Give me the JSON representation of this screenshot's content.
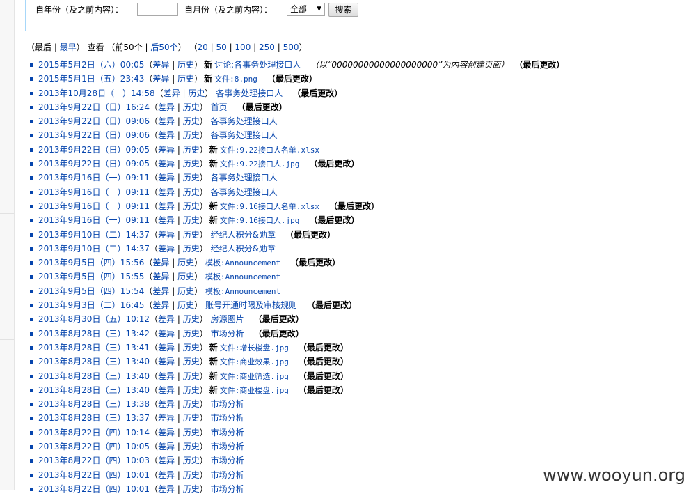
{
  "filter": {
    "year_label": "自年份（及之前内容）：",
    "year_value": "",
    "month_label": "自月份（及之前内容）：",
    "month_value": "全部",
    "search_label": "搜索"
  },
  "nav": {
    "newest": "最后",
    "oldest": "最早",
    "view": "查看",
    "prev50": "前50个",
    "next50": "后50个",
    "limits": [
      "20",
      "50",
      "100",
      "250",
      "500"
    ]
  },
  "labels": {
    "diff": "差异",
    "hist": "历史",
    "new_flag": "新",
    "current": "（最后更改）"
  },
  "entries": [
    {
      "date": "2015年5月2日（六）00:05",
      "new": true,
      "title": "讨论:各事务处理接口人",
      "summary": "（以“00000000000000000000”为内容创建页面）",
      "current": true
    },
    {
      "date": "2015年5月1日（五）23:43",
      "new": true,
      "title": "文件:8.png",
      "current": true
    },
    {
      "date": "2013年10月28日（一）14:58",
      "new": false,
      "title": "各事务处理接口人",
      "current": true
    },
    {
      "date": "2013年9月22日（日）16:24",
      "new": false,
      "title": "首页",
      "current": true
    },
    {
      "date": "2013年9月22日（日）09:06",
      "new": false,
      "title": "各事务处理接口人",
      "current": false
    },
    {
      "date": "2013年9月22日（日）09:06",
      "new": false,
      "title": "各事务处理接口人",
      "current": false
    },
    {
      "date": "2013年9月22日（日）09:05",
      "new": true,
      "title": "文件:9.22接口人名单.xlsx",
      "current": false
    },
    {
      "date": "2013年9月22日（日）09:05",
      "new": true,
      "title": "文件:9.22接口人.jpg",
      "current": true
    },
    {
      "date": "2013年9月16日（一）09:11",
      "new": false,
      "title": "各事务处理接口人",
      "current": false
    },
    {
      "date": "2013年9月16日（一）09:11",
      "new": false,
      "title": "各事务处理接口人",
      "current": false
    },
    {
      "date": "2013年9月16日（一）09:11",
      "new": true,
      "title": "文件:9.16接口人名单.xlsx",
      "current": true
    },
    {
      "date": "2013年9月16日（一）09:11",
      "new": true,
      "title": "文件:9.16接口人.jpg",
      "current": true
    },
    {
      "date": "2013年9月10日（二）14:37",
      "new": false,
      "title": "经纪人积分&勋章",
      "current": true
    },
    {
      "date": "2013年9月10日（二）14:37",
      "new": false,
      "title": "经纪人积分&勋章",
      "current": false
    },
    {
      "date": "2013年9月5日（四）15:56",
      "new": false,
      "title": "模板:Announcement",
      "current": true
    },
    {
      "date": "2013年9月5日（四）15:55",
      "new": false,
      "title": "模板:Announcement",
      "current": false
    },
    {
      "date": "2013年9月5日（四）15:54",
      "new": false,
      "title": "模板:Announcement",
      "current": false
    },
    {
      "date": "2013年9月3日（二）16:45",
      "new": false,
      "title": "账号开通时限及审核规则",
      "current": true
    },
    {
      "date": "2013年8月30日（五）10:12",
      "new": false,
      "title": "房源图片",
      "current": true
    },
    {
      "date": "2013年8月28日（三）13:42",
      "new": false,
      "title": "市场分析",
      "current": true
    },
    {
      "date": "2013年8月28日（三）13:41",
      "new": true,
      "title": "文件:增长楼盘.jpg",
      "current": true
    },
    {
      "date": "2013年8月28日（三）13:40",
      "new": true,
      "title": "文件:商业效果.jpg",
      "current": true
    },
    {
      "date": "2013年8月28日（三）13:40",
      "new": true,
      "title": "文件:商业筛选.jpg",
      "current": true
    },
    {
      "date": "2013年8月28日（三）13:40",
      "new": true,
      "title": "文件:商业楼盘.jpg",
      "current": true
    },
    {
      "date": "2013年8月28日（三）13:38",
      "new": false,
      "title": "市场分析",
      "current": false
    },
    {
      "date": "2013年8月28日（三）13:37",
      "new": false,
      "title": "市场分析",
      "current": false
    },
    {
      "date": "2013年8月22日（四）10:14",
      "new": false,
      "title": "市场分析",
      "current": false
    },
    {
      "date": "2013年8月22日（四）10:05",
      "new": false,
      "title": "市场分析",
      "current": false
    },
    {
      "date": "2013年8月22日（四）10:03",
      "new": false,
      "title": "市场分析",
      "current": false
    },
    {
      "date": "2013年8月22日（四）10:01",
      "new": false,
      "title": "市场分析",
      "current": false
    },
    {
      "date": "2013年8月22日（四）10:01",
      "new": false,
      "title": "市场分析",
      "current": false
    }
  ],
  "watermark": "www.wooyun.org"
}
